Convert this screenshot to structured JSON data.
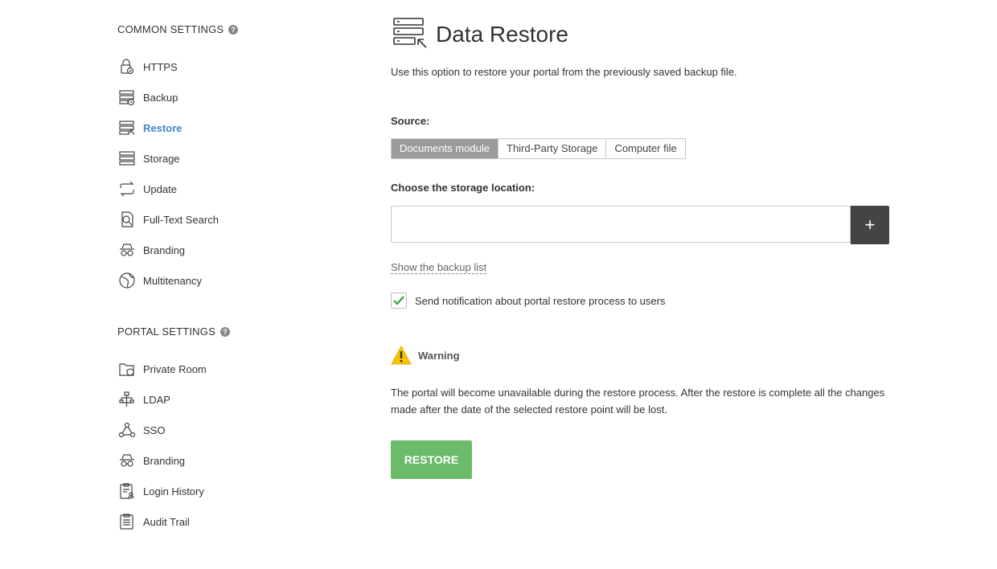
{
  "sidebar": {
    "common_title": "COMMON SETTINGS",
    "common_items": [
      {
        "label": "HTTPS",
        "icon": "lock-file-icon"
      },
      {
        "label": "Backup",
        "icon": "backup-icon"
      },
      {
        "label": "Restore",
        "icon": "restore-icon"
      },
      {
        "label": "Storage",
        "icon": "storage-icon"
      },
      {
        "label": "Update",
        "icon": "update-icon"
      },
      {
        "label": "Full-Text Search",
        "icon": "search-document-icon"
      },
      {
        "label": "Branding",
        "icon": "branding-icon"
      },
      {
        "label": "Multitenancy",
        "icon": "globe-icon"
      }
    ],
    "portal_title": "PORTAL SETTINGS",
    "portal_items": [
      {
        "label": "Private Room",
        "icon": "private-folder-icon"
      },
      {
        "label": "LDAP",
        "icon": "ldap-icon"
      },
      {
        "label": "SSO",
        "icon": "sso-icon"
      },
      {
        "label": "Branding",
        "icon": "branding-icon"
      },
      {
        "label": "Login History",
        "icon": "login-history-icon"
      },
      {
        "label": "Audit Trail",
        "icon": "audit-trail-icon"
      }
    ],
    "active_item": "Restore",
    "active_color": "#3d89c8"
  },
  "main": {
    "title": "Data Restore",
    "description": "Use this option to restore your portal from the previously saved backup file.",
    "source_label": "Source:",
    "source_options": [
      "Documents module",
      "Third-Party Storage",
      "Computer file"
    ],
    "source_selected": "Documents module",
    "storage_label": "Choose the storage location:",
    "storage_value": "",
    "add_button": "+",
    "backup_list_link": "Show the backup list",
    "notify_label": "Send notification about portal restore process to users",
    "notify_checked": true,
    "warning_title": "Warning",
    "warning_text": "The portal will become unavailable during the restore process. After the restore is complete all the changes made after the date of the selected restore point will be lost.",
    "restore_button": "RESTORE",
    "restore_color": "#6cbb6a"
  }
}
